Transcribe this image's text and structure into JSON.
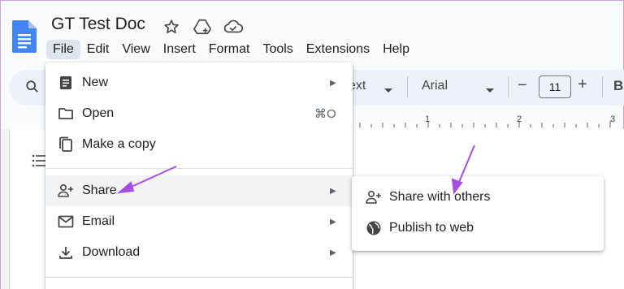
{
  "document": {
    "title": "GT Test Doc",
    "title_icons": [
      "star-icon",
      "move-to-drive-icon",
      "cloud-saved-icon"
    ]
  },
  "menubar": {
    "items": [
      "File",
      "Edit",
      "View",
      "Insert",
      "Format",
      "Tools",
      "Extensions",
      "Help"
    ],
    "active": "File"
  },
  "toolbar": {
    "style_label": "ext",
    "font_label": "Arial",
    "font_size": "11",
    "minus": "−",
    "plus": "+",
    "bold": "B"
  },
  "ruler": {
    "numbers": [
      "1",
      "2",
      "3"
    ]
  },
  "file_menu": {
    "new": {
      "label": "New",
      "icon": "doc-icon",
      "arrow": "▶"
    },
    "open": {
      "label": "Open",
      "icon": "folder-icon",
      "shortcut": "⌘O"
    },
    "make_copy": {
      "label": "Make a copy",
      "icon": "copy-icon"
    },
    "share": {
      "label": "Share",
      "icon": "person-add-icon",
      "arrow": "▶"
    },
    "email": {
      "label": "Email",
      "icon": "mail-icon",
      "arrow": "▶"
    },
    "download": {
      "label": "Download",
      "icon": "download-icon",
      "arrow": "▶"
    }
  },
  "share_menu": {
    "share_with_others": {
      "label": "Share with others",
      "icon": "person-add-icon"
    },
    "publish_to_web": {
      "label": "Publish to web",
      "icon": "globe-icon"
    }
  },
  "colors": {
    "accent": "#1a73e8",
    "annotation_arrow": "#a64de3",
    "menu_highlight": "#f1f3f4",
    "toolbar_bg": "#edf2fa"
  }
}
